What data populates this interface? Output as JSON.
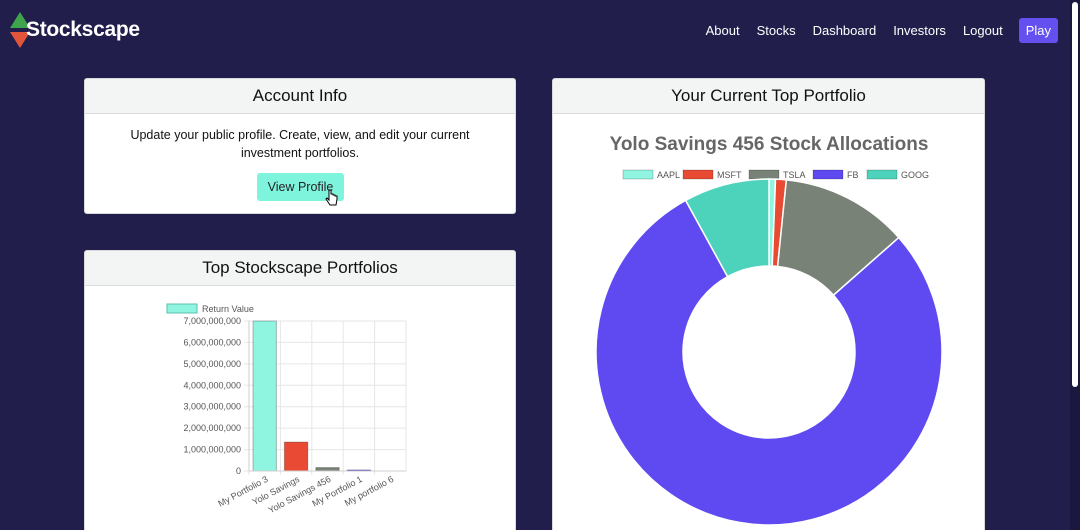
{
  "brand": {
    "name": "Stockscape"
  },
  "nav": {
    "links": [
      "About",
      "Stocks",
      "Dashboard",
      "Investors",
      "Logout"
    ],
    "play": "Play"
  },
  "account_card": {
    "title": "Account Info",
    "text": "Update your public profile. Create, view, and edit your current investment portfolios.",
    "button": "View Profile"
  },
  "top_card": {
    "title": "Top Stockscape Portfolios"
  },
  "portfolio_card": {
    "title": "Your Current Top Portfolio"
  },
  "colors": {
    "background": "#211e4b",
    "accent": "#6450ef",
    "aapl": "#8ff5e0",
    "msft": "#e84a33",
    "tsla": "#798276",
    "fb": "#5e4af0",
    "goog": "#4dd3bb"
  },
  "chart_data": [
    {
      "type": "bar",
      "title": "",
      "legend": [
        "Return Value"
      ],
      "categories": [
        "My Portfolio 3",
        "Yolo Savings",
        "Yolo Savings 456",
        "My Portfolio 1",
        "My portfolio 6"
      ],
      "values": [
        7000000000,
        1350000000,
        160000000,
        50000000,
        0
      ],
      "colors": [
        "#8ff5e0",
        "#e84a33",
        "#798276",
        "#5e4af0",
        "#4dd3bb"
      ],
      "ylim": [
        0,
        7000000000
      ],
      "yticks": [
        "7,000,000,000",
        "6,000,000,000",
        "5,000,000,000",
        "4,000,000,000",
        "3,000,000,000",
        "2,000,000,000",
        "1,000,000,000",
        "0"
      ],
      "grid": true,
      "legend_position": "top"
    },
    {
      "type": "pie",
      "title": "Yolo Savings 456 Stock Allocations",
      "labels": [
        "AAPL",
        "MSFT",
        "TSLA",
        "FB",
        "GOOG"
      ],
      "values": [
        0.6,
        1,
        11.9,
        78.5,
        8
      ],
      "colors": [
        "#8ff5e0",
        "#e84a33",
        "#798276",
        "#5e4af0",
        "#4dd3bb"
      ],
      "legend_position": "top"
    }
  ]
}
